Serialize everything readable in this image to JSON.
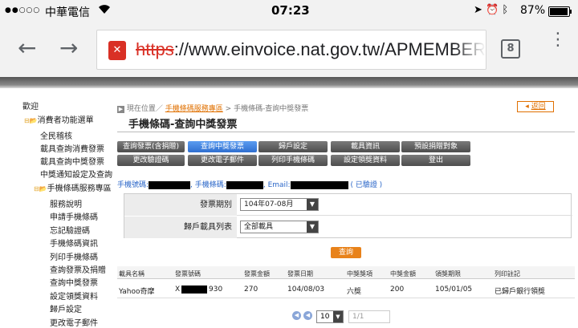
{
  "status_bar": {
    "signal_dots": "●●○○○",
    "carrier": "中華電信",
    "time": "07:23",
    "battery": "87%",
    "battery_level": 0.87
  },
  "browser": {
    "url_protocol": "https",
    "url_rest": "://www.einvoice.nat.gov.tw/APMEMBERVA",
    "url_host": "www.einvoice.nat.gov.tw",
    "tab_count": "8"
  },
  "sidebar": {
    "welcome": "歡迎",
    "menu_root": "消費者功能選單",
    "items_level1": [
      "全民稽核",
      "載具查詢消費發票",
      "載具查詢中獎發票",
      "中獎通知設定及查詢"
    ],
    "barcode_root": "手機條碼服務專區",
    "items_level2": [
      "服務說明",
      "申請手機條碼",
      "忘記驗證碼",
      "手機條碼資訊",
      "列印手機條碼",
      "查詢發票及捐贈",
      "查詢中獎發票",
      "設定領獎資料",
      "歸戶設定",
      "更改電子郵件"
    ]
  },
  "breadcrumb": {
    "prefix": "現在位置／",
    "link": "手機條碼服務專區",
    "sep": " > ",
    "current": "手機條碼-查詢中獎發票"
  },
  "back_button": "返回",
  "page_title": "手機條碼-查詢中獎發票",
  "func_buttons_row1": [
    "查詢發票(含捐贈)",
    "查詢中獎發票",
    "歸戶設定",
    "載具資訊",
    "預設捐贈對象"
  ],
  "func_buttons_row2": [
    "更改驗證碼",
    "更改電子郵件",
    "列印手機條碼",
    "設定領獎資料",
    "登出"
  ],
  "info": {
    "barcode_label": "手機號碼:",
    "barcode_label2": "手機條碼:",
    "email_label": "Email:",
    "verified": "( 已驗證 )"
  },
  "form": {
    "period_label": "發票期別",
    "period_value": "104年07-08月",
    "carrier_label": "歸戶載具列表",
    "carrier_value": "全部載具"
  },
  "query_button": "查詢",
  "table": {
    "headers": [
      "載具名稱",
      "發票號碼",
      "發票金額",
      "發票日期",
      "中獎獎項",
      "中獎金額",
      "領獎期限",
      "列印註記"
    ],
    "rows": [
      [
        "Yahoo奇摩",
        "X",
        "930",
        "270",
        "104/08/03",
        "六獎",
        "200",
        "105/01/05",
        "已歸戶銀行領獎"
      ]
    ]
  },
  "pager": {
    "page_size": "10",
    "page_info": "1/1"
  }
}
